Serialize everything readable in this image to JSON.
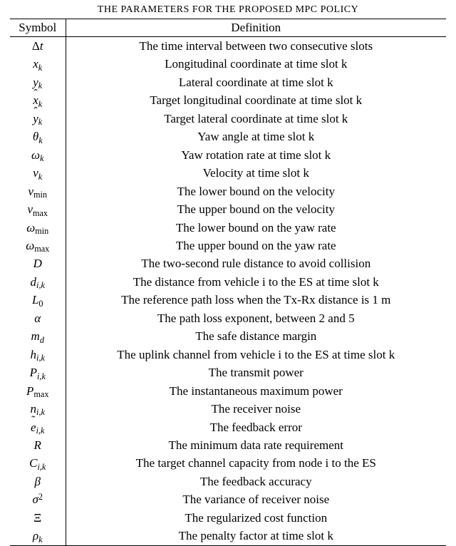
{
  "title": "THE PARAMETERS FOR THE PROPOSED MPC POLICY",
  "headers": {
    "symbol": "Symbol",
    "definition": "Definition"
  },
  "rows": [
    {
      "sym_html": "<span class='rm'>Δ</span>t",
      "def": "The time interval between two consecutive slots"
    },
    {
      "sym_html": "x<span class='subi'>k</span>",
      "def": "Longitudinal coordinate at time slot k"
    },
    {
      "sym_html": "y<span class='subi'>k</span>",
      "def": "Lateral coordinate at time slot k"
    },
    {
      "sym_html": "<span class='hat'>x</span><span class='subi'>k</span>",
      "def": "Target longitudinal coordinate at time slot k"
    },
    {
      "sym_html": "<span class='hat'>y</span><span class='subi'>k</span>",
      "def": "Target lateral coordinate at time slot k"
    },
    {
      "sym_html": "θ<span class='subi'>k</span>",
      "def": "Yaw angle at time slot k"
    },
    {
      "sym_html": "ω<span class='subi'>k</span>",
      "def": "Yaw rotation rate at time slot k"
    },
    {
      "sym_html": "v<span class='subi'>k</span>",
      "def": "Velocity at time slot k"
    },
    {
      "sym_html": "v<span class='sub'>min</span>",
      "def": "The lower bound on the velocity"
    },
    {
      "sym_html": "v<span class='sub'>max</span>",
      "def": "The upper bound on the velocity"
    },
    {
      "sym_html": "ω<span class='sub'>min</span>",
      "def": "The lower bound on the yaw rate"
    },
    {
      "sym_html": "ω<span class='sub'>max</span>",
      "def": "The upper bound on the yaw rate"
    },
    {
      "sym_html": "D",
      "def": "The two-second rule distance to avoid collision"
    },
    {
      "sym_html": "d<span class='subi'>i,k</span>",
      "def": "The distance from vehicle i to the ES at time slot k"
    },
    {
      "sym_html": "L<span class='sub'>0</span>",
      "def": "The reference path loss when the Tx-Rx distance is 1 m"
    },
    {
      "sym_html": "α",
      "def": "The path loss exponent, between 2 and 5"
    },
    {
      "sym_html": "m<span class='subi'>d</span>",
      "def": "The safe distance margin"
    },
    {
      "sym_html": "h<span class='subi'>i,k</span>",
      "def": "The uplink channel from vehicle i to the ES at time slot k"
    },
    {
      "sym_html": "P<span class='subi'>i,k</span>",
      "def": "The transmit power"
    },
    {
      "sym_html": "P<span class='sub'>max</span>",
      "def": "The instantaneous maximum power"
    },
    {
      "sym_html": "n<span class='subi'>i,k</span>",
      "def": "The receiver noise"
    },
    {
      "sym_html": "<span class='tilde'>e</span><span class='subi'>i,k</span>",
      "def": "The feedback error"
    },
    {
      "sym_html": "R",
      "def": "The minimum data rate requirement"
    },
    {
      "sym_html": "C<span class='subi'>i,k</span>",
      "def": "The target channel capacity from node i to the ES"
    },
    {
      "sym_html": "β",
      "def": "The feedback accuracy"
    },
    {
      "sym_html": "σ<span class='sup'>2</span>",
      "def": "The variance of receiver noise"
    },
    {
      "sym_html": "<span class='rm'>Ξ</span>",
      "def": "The regularized cost function"
    },
    {
      "sym_html": "ρ<span class='subi'>k</span>",
      "def": "The penalty factor at time slot k"
    }
  ],
  "chart_data": {
    "type": "table",
    "title": "THE PARAMETERS FOR THE PROPOSED MPC POLICY",
    "columns": [
      "Symbol",
      "Definition"
    ],
    "rows": [
      [
        "Δt",
        "The time interval between two consecutive slots"
      ],
      [
        "x_k",
        "Longitudinal coordinate at time slot k"
      ],
      [
        "y_k",
        "Lateral coordinate at time slot k"
      ],
      [
        "x̂_k",
        "Target longitudinal coordinate at time slot k"
      ],
      [
        "ŷ_k",
        "Target lateral coordinate at time slot k"
      ],
      [
        "θ_k",
        "Yaw angle at time slot k"
      ],
      [
        "ω_k",
        "Yaw rotation rate at time slot k"
      ],
      [
        "v_k",
        "Velocity at time slot k"
      ],
      [
        "v_min",
        "The lower bound on the velocity"
      ],
      [
        "v_max",
        "The upper bound on the velocity"
      ],
      [
        "ω_min",
        "The lower bound on the yaw rate"
      ],
      [
        "ω_max",
        "The upper bound on the yaw rate"
      ],
      [
        "D",
        "The two-second rule distance to avoid collision"
      ],
      [
        "d_{i,k}",
        "The distance from vehicle i to the ES at time slot k"
      ],
      [
        "L_0",
        "The reference path loss when the Tx-Rx distance is 1 m"
      ],
      [
        "α",
        "The path loss exponent, between 2 and 5"
      ],
      [
        "m_d",
        "The safe distance margin"
      ],
      [
        "h_{i,k}",
        "The uplink channel from vehicle i to the ES at time slot k"
      ],
      [
        "P_{i,k}",
        "The transmit power"
      ],
      [
        "P_max",
        "The instantaneous maximum power"
      ],
      [
        "n_{i,k}",
        "The receiver noise"
      ],
      [
        "ẽ_{i,k}",
        "The feedback error"
      ],
      [
        "R",
        "The minimum data rate requirement"
      ],
      [
        "C_{i,k}",
        "The target channel capacity from node i to the ES"
      ],
      [
        "β",
        "The feedback accuracy"
      ],
      [
        "σ^2",
        "The variance of receiver noise"
      ],
      [
        "Ξ",
        "The regularized cost function"
      ],
      [
        "ρ_k",
        "The penalty factor at time slot k"
      ]
    ]
  }
}
